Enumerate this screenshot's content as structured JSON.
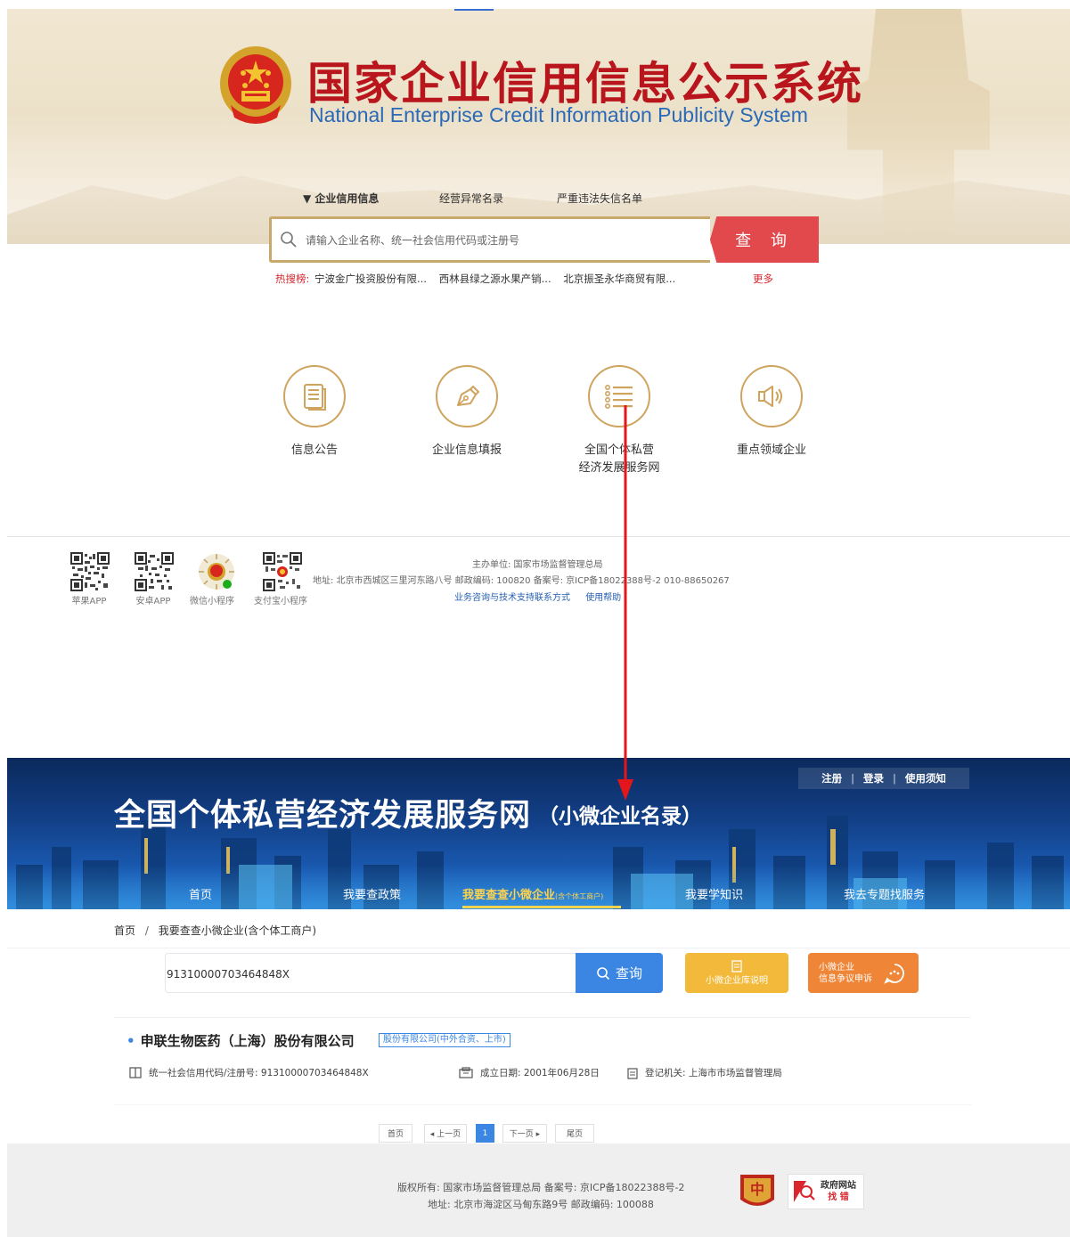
{
  "top_site": {
    "title_cn": "国家企业信用信息公示系统",
    "title_en": "National Enterprise Credit Information Publicity System",
    "search_tabs": [
      "▼ 企业信用信息",
      "经营异常名录",
      "严重违法失信名单"
    ],
    "search_placeholder": "请输入企业名称、统一社会信用代码或注册号",
    "search_button": "查 询",
    "hot_label": "热搜榜:",
    "hot_items": [
      "宁波金广投资股份有限...",
      "西林县绿之源水果产销...",
      "北京振圣永华商贸有限..."
    ],
    "hot_more": "更多",
    "features": [
      {
        "label": "信息公告",
        "icon": "document-icon"
      },
      {
        "label": "企业信息填报",
        "icon": "pen-icon"
      },
      {
        "label": "全国个体私营经济发展服务网",
        "icon": "list-icon",
        "label_line1": "全国个体私营",
        "label_line2": "经济发展服务网"
      },
      {
        "label": "重点领域企业",
        "icon": "speaker-icon"
      }
    ],
    "qr_codes": [
      {
        "label": "苹果APP"
      },
      {
        "label": "安卓APP"
      },
      {
        "label": "微信小程序"
      },
      {
        "label": "支付宝小程序"
      }
    ],
    "footer": {
      "sponsor": "主办单位: 国家市场监督管理总局",
      "address": "地址: 北京市西城区三里河东路八号  邮政编码: 100820  备案号: 京ICP备18022388号-2  010-88650267",
      "links": [
        "业务咨询与技术支持联系方式",
        "使用帮助"
      ]
    }
  },
  "annotation": {
    "arrow_color": "#e3161b"
  },
  "bottom_site": {
    "title": "全国个体私营经济发展服务网",
    "subtitle": "（小微企业名录）",
    "top_links": [
      "注册",
      "登录",
      "使用须知"
    ],
    "top_link_sep": "|",
    "nav": [
      "首页",
      "我要查政策",
      "我要查查小微企业",
      "我要学知识",
      "我去专题找服务"
    ],
    "nav_active_suffix": "(含个体工商户)",
    "breadcrumb": [
      "首页",
      "我要查查小微企业(含个体工商户)"
    ],
    "breadcrumb_sep": "/",
    "search_value": "91310000703464848X",
    "search_button": "查询",
    "lib_button": "小微企业库说明",
    "dispute_button_line1": "小微企业",
    "dispute_button_line2": "信息争议申诉",
    "result": {
      "name": "申联生物医药（上海）股份有限公司",
      "type": "股份有限公司(中外合资、上市)",
      "code": "统一社会信用代码/注册号: 91310000703464848X",
      "date": "成立日期: 2001年06月28日",
      "authority": "登记机关: 上海市市场监督管理局"
    },
    "pagination": {
      "first": "首页",
      "prev": "◂ 上一页",
      "current": "1",
      "next": "下一页 ▸",
      "last": "尾页"
    },
    "footer": {
      "line1": "版权所有: 国家市场监督管理总局 备案号: 京ICP备18022388号-2",
      "line2": "地址: 北京市海淀区马甸东路9号 邮政编码: 100088",
      "badge_text_1": "政府网站",
      "badge_text_2": "找 错"
    }
  },
  "colors": {
    "title_red": "#b8151c",
    "accent_gold": "#cfa45f",
    "search_red": "#e2494d",
    "blue": "#3b86e2",
    "nav_active": "#ffd34e"
  }
}
